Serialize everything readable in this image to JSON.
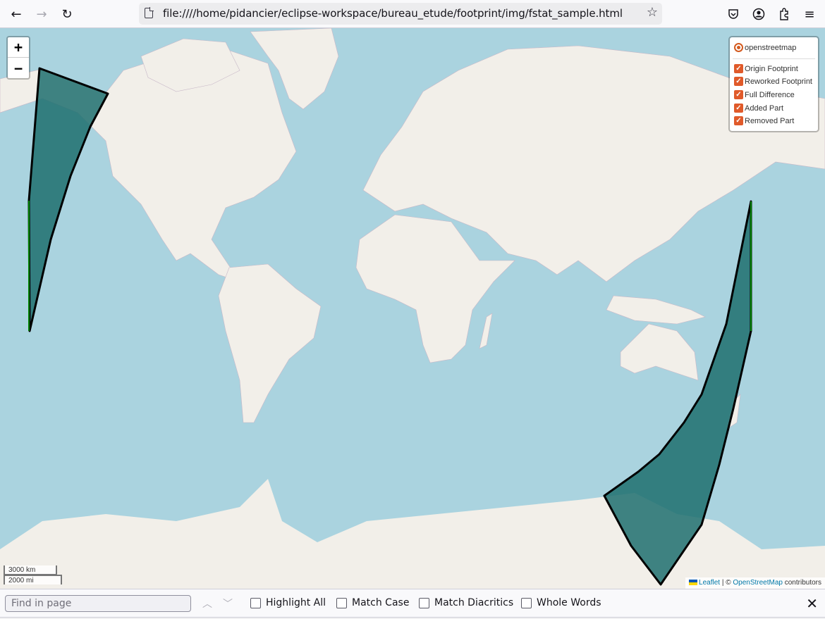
{
  "browser": {
    "nav": {
      "back_icon": "arrow-left-icon",
      "forward_icon": "arrow-right-icon",
      "reload_icon": "reload-icon"
    },
    "url": "file:////home/pidancier/eclipse-workspace/bureau_etude/footprint/img/fstat_sample.html",
    "bookmark_icon": "star-icon",
    "toolbar_icons": [
      "pocket-icon",
      "account-icon",
      "extensions-icon",
      "menu-icon"
    ]
  },
  "map": {
    "zoom_in_label": "+",
    "zoom_out_label": "−",
    "layers": {
      "base_layers": [
        {
          "label": "openstreetmap",
          "selected": true
        }
      ],
      "overlays": [
        {
          "label": "Origin Footprint",
          "checked": true
        },
        {
          "label": "Reworked Footprint",
          "checked": true
        },
        {
          "label": "Full Difference",
          "checked": true
        },
        {
          "label": "Added Part",
          "checked": true
        },
        {
          "label": "Removed Part",
          "checked": true
        }
      ],
      "accent_color": "#e05a2a"
    },
    "scale": {
      "metric": "3000 km",
      "imperial": "2000 mi"
    },
    "attribution": {
      "leaflet": "Leaflet",
      "separator": " | © ",
      "osm": "OpenStreetMap",
      "suffix": " contributors"
    },
    "colors": {
      "water": "#aad3df",
      "land": "#f2efe9",
      "footprint_fill": "#1f6f6f",
      "footprint_stroke": "#000000",
      "edge_green": "#008000"
    }
  },
  "findbar": {
    "placeholder": "Find in page",
    "value": "",
    "options": [
      {
        "label": "Highlight All",
        "checked": false
      },
      {
        "label": "Match Case",
        "checked": false
      },
      {
        "label": "Match Diacritics",
        "checked": false
      },
      {
        "label": "Whole Words",
        "checked": false
      }
    ]
  }
}
